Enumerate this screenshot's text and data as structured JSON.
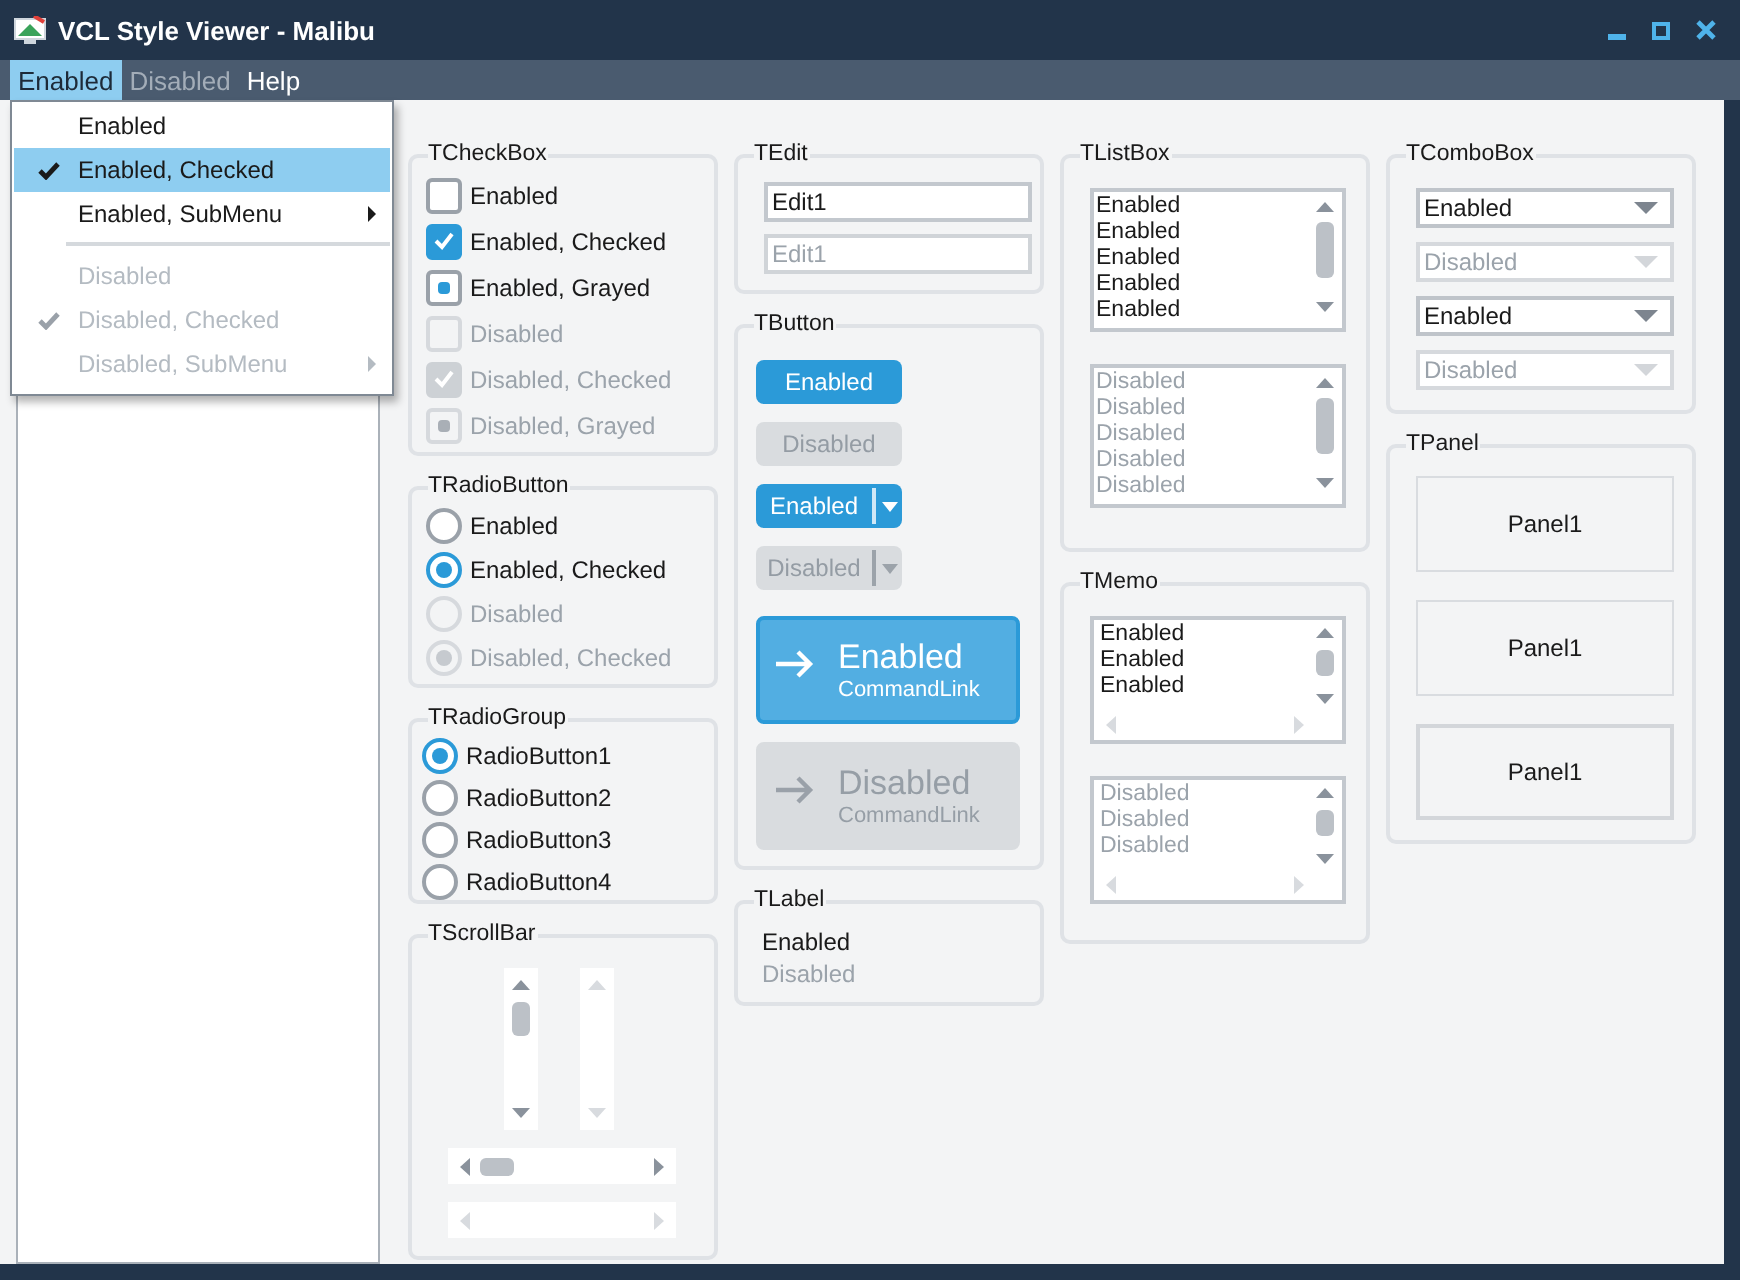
{
  "window": {
    "title": "VCL Style Viewer - Malibu"
  },
  "menu_bar": [
    {
      "label": "Enabled",
      "selected": true,
      "disabled": false
    },
    {
      "label": "Disabled",
      "selected": false,
      "disabled": true
    },
    {
      "label": "Help",
      "selected": false,
      "disabled": false
    }
  ],
  "dropdown": {
    "items": [
      {
        "kind": "item",
        "label": "Enabled",
        "checked": false,
        "disabled": false,
        "submenu": false,
        "selected": false
      },
      {
        "kind": "item",
        "label": "Enabled, Checked",
        "checked": true,
        "disabled": false,
        "submenu": false,
        "selected": true
      },
      {
        "kind": "item",
        "label": "Enabled, SubMenu",
        "checked": false,
        "disabled": false,
        "submenu": true,
        "selected": false
      },
      {
        "kind": "separator"
      },
      {
        "kind": "item",
        "label": "Disabled",
        "checked": false,
        "disabled": true,
        "submenu": false,
        "selected": false
      },
      {
        "kind": "item",
        "label": "Disabled, Checked",
        "checked": true,
        "disabled": true,
        "submenu": false,
        "selected": false
      },
      {
        "kind": "item",
        "label": "Disabled, SubMenu",
        "checked": false,
        "disabled": true,
        "submenu": true,
        "selected": false
      }
    ]
  },
  "checkbox_group": {
    "title": "TCheckBox",
    "items": [
      {
        "label": "Enabled",
        "checked": false,
        "grayed": false,
        "disabled": false
      },
      {
        "label": "Enabled, Checked",
        "checked": true,
        "grayed": false,
        "disabled": false
      },
      {
        "label": "Enabled, Grayed",
        "checked": false,
        "grayed": true,
        "disabled": false
      },
      {
        "label": "Disabled",
        "checked": false,
        "grayed": false,
        "disabled": true
      },
      {
        "label": "Disabled, Checked",
        "checked": true,
        "grayed": false,
        "disabled": true
      },
      {
        "label": "Disabled, Grayed",
        "checked": false,
        "grayed": true,
        "disabled": true
      }
    ]
  },
  "radio_button_group": {
    "title": "TRadioButton",
    "items": [
      {
        "label": "Enabled",
        "checked": false,
        "disabled": false
      },
      {
        "label": "Enabled, Checked",
        "checked": true,
        "disabled": false
      },
      {
        "label": "Disabled",
        "checked": false,
        "disabled": true
      },
      {
        "label": "Disabled, Checked",
        "checked": true,
        "disabled": true
      }
    ]
  },
  "radio_group": {
    "title": "TRadioGroup",
    "items": [
      {
        "label": "RadioButton1",
        "selected": true
      },
      {
        "label": "RadioButton2",
        "selected": false
      },
      {
        "label": "RadioButton3",
        "selected": false
      },
      {
        "label": "RadioButton4",
        "selected": false
      }
    ]
  },
  "scrollbar_group": {
    "title": "TScrollBar",
    "scrollbars": [
      {
        "kind": "vertical",
        "disabled": false
      },
      {
        "kind": "vertical",
        "disabled": true
      },
      {
        "kind": "horizontal",
        "disabled": false
      },
      {
        "kind": "horizontal",
        "disabled": true
      }
    ]
  },
  "edit_group": {
    "title": "TEdit",
    "fields": [
      {
        "value": "Edit1",
        "disabled": false
      },
      {
        "value": "Edit1",
        "disabled": true
      }
    ]
  },
  "button_group": {
    "title": "TButton",
    "buttons": [
      {
        "kind": "button",
        "label": "Enabled",
        "disabled": false
      },
      {
        "kind": "button",
        "label": "Disabled",
        "disabled": true
      },
      {
        "kind": "split",
        "label": "Enabled",
        "disabled": false
      },
      {
        "kind": "split",
        "label": "Disabled",
        "disabled": true
      },
      {
        "kind": "command_link",
        "label": "Enabled",
        "note": "CommandLink",
        "disabled": false
      },
      {
        "kind": "command_link",
        "label": "Disabled",
        "note": "CommandLink",
        "disabled": true
      }
    ]
  },
  "label_group": {
    "title": "TLabel",
    "labels": [
      {
        "text": "Enabled",
        "disabled": false
      },
      {
        "text": "Disabled",
        "disabled": true
      }
    ]
  },
  "listbox_group": {
    "title": "TListBox",
    "lists": [
      {
        "items": [
          "Enabled",
          "Enabled",
          "Enabled",
          "Enabled",
          "Enabled"
        ],
        "disabled": false
      },
      {
        "items": [
          "Disabled",
          "Disabled",
          "Disabled",
          "Disabled",
          "Disabled"
        ],
        "disabled": true
      }
    ]
  },
  "memo_group": {
    "title": "TMemo",
    "memos": [
      {
        "lines": [
          "Enabled",
          "Enabled",
          "Enabled"
        ],
        "disabled": false
      },
      {
        "lines": [
          "Disabled",
          "Disabled",
          "Disabled"
        ],
        "disabled": true
      }
    ]
  },
  "combobox_group": {
    "title": "TComboBox",
    "combos": [
      {
        "value": "Enabled",
        "disabled": false
      },
      {
        "value": "Disabled",
        "disabled": true
      },
      {
        "value": "Enabled",
        "disabled": false
      },
      {
        "value": "Disabled",
        "disabled": true
      }
    ]
  },
  "panel_group": {
    "title": "TPanel",
    "panels": [
      {
        "caption": "Panel1",
        "raised": false
      },
      {
        "caption": "Panel1",
        "raised": false
      },
      {
        "caption": "Panel1",
        "raised": true
      }
    ]
  }
}
